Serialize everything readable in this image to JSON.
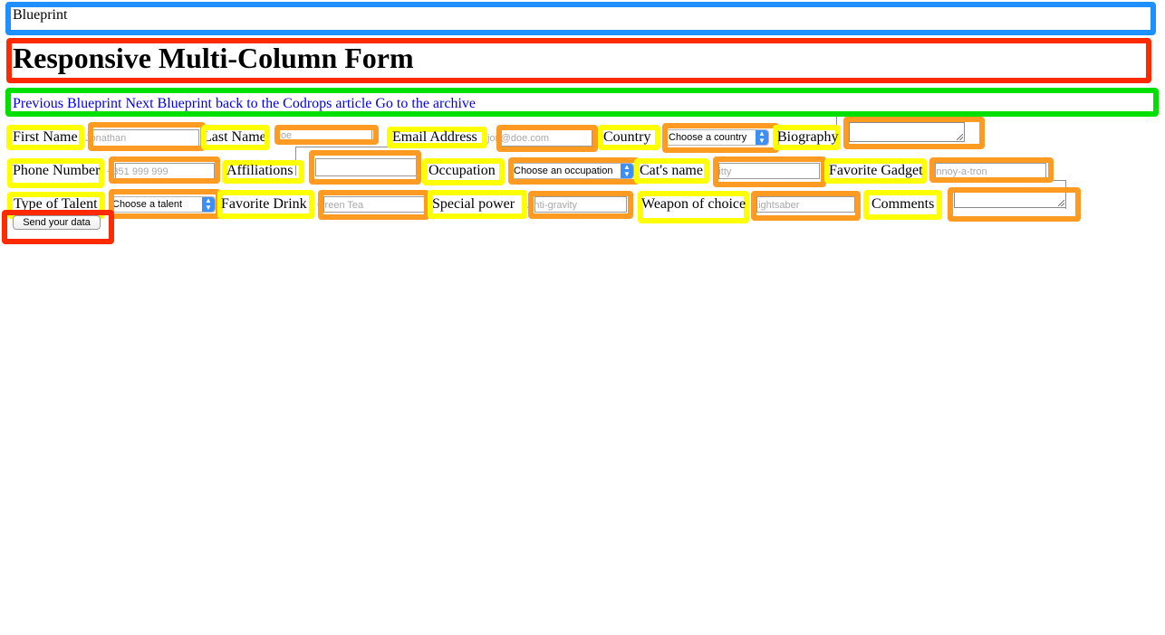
{
  "header": {
    "site_title": "Blueprint",
    "page_title": "Responsive Multi-Column Form"
  },
  "nav": {
    "previous": "Previous Blueprint",
    "next": "Next Blueprint",
    "back": "back to the Codrops article",
    "archive": "Go to the archive"
  },
  "form": {
    "first_name": {
      "label": "First Name",
      "placeholder": "Jonathan"
    },
    "last_name": {
      "label": "Last Name",
      "placeholder": "Doe"
    },
    "email": {
      "label": "Email Address",
      "placeholder": "jon@doe.com"
    },
    "country": {
      "label": "Country",
      "value": "Choose a country"
    },
    "biography": {
      "label": "Biography"
    },
    "phone": {
      "label": "Phone Number",
      "placeholder": "+351 999 999"
    },
    "affiliations": {
      "label": "Affiliations"
    },
    "occupation": {
      "label": "Occupation",
      "value": "Choose an occupation"
    },
    "cats_name": {
      "label": "Cat's name",
      "placeholder": "Kitty"
    },
    "gadget": {
      "label": "Favorite Gadget",
      "placeholder": "Annoy-a-tron"
    },
    "talent": {
      "label": "Type of Talent",
      "value": "Choose a talent"
    },
    "drink": {
      "label": "Favorite Drink",
      "placeholder": "Green Tea"
    },
    "power": {
      "label": "Special power",
      "placeholder": "Anti-gravity"
    },
    "weapon": {
      "label": "Weapon of choice",
      "placeholder": "Lightsaber"
    },
    "comments": {
      "label": "Comments"
    },
    "submit": "Send your data"
  },
  "colors": {
    "highlight_blue": "#1e90ff",
    "highlight_red": "#ff2a00",
    "highlight_green": "#00e000",
    "highlight_yellow": "#ffff00",
    "highlight_orange": "#ff9a22",
    "link": "#0000ee",
    "select_arrow": "#3b8ff5"
  },
  "icons": {
    "select_arrow": "select-arrows-icon",
    "textarea_resize": "resize-grip-icon"
  }
}
